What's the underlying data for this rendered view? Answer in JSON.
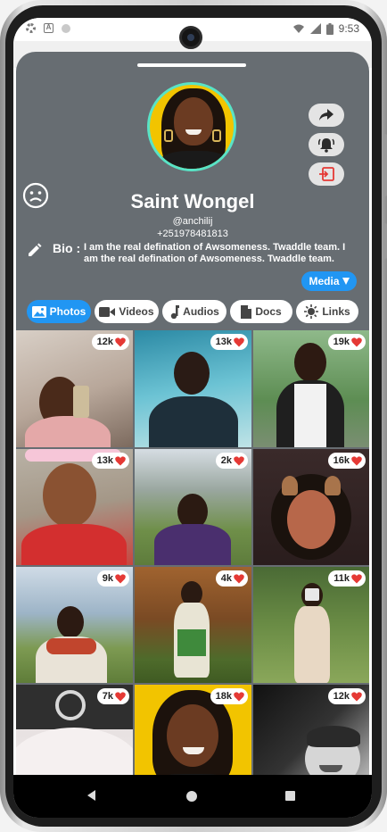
{
  "status_bar": {
    "time": "9:53"
  },
  "profile": {
    "name": "Saint Wongel",
    "handle": "@anchilij",
    "phone": "+251978481813",
    "bio_label": "Bio :",
    "bio": "I am the real defination of Awsomeness. Twaddle team. I am the real defination of Awsomeness. Twaddle team."
  },
  "actions": [
    {
      "icon": "share-icon"
    },
    {
      "icon": "alarm-bell-icon"
    },
    {
      "icon": "logout-icon"
    }
  ],
  "media_button": {
    "label": "Media"
  },
  "tabs": [
    {
      "label": "Photos",
      "icon": "image-icon",
      "active": true
    },
    {
      "label": "Videos",
      "icon": "video-icon",
      "active": false
    },
    {
      "label": "Audios",
      "icon": "music-note-icon",
      "active": false
    },
    {
      "label": "Docs",
      "icon": "document-icon",
      "active": false
    },
    {
      "label": "Links",
      "icon": "sun-icon",
      "active": false
    }
  ],
  "photos": [
    {
      "likes": "12k"
    },
    {
      "likes": "13k"
    },
    {
      "likes": "19k"
    },
    {
      "likes": "13k"
    },
    {
      "likes": "2k"
    },
    {
      "likes": "16k"
    },
    {
      "likes": "9k"
    },
    {
      "likes": "4k"
    },
    {
      "likes": "11k"
    },
    {
      "likes": "7k"
    },
    {
      "likes": "18k"
    },
    {
      "likes": "12k"
    }
  ],
  "colors": {
    "sheet": "#676d72",
    "accent": "#2196f3",
    "avatar_ring": "#59e3c6",
    "heart": "#e53935"
  }
}
